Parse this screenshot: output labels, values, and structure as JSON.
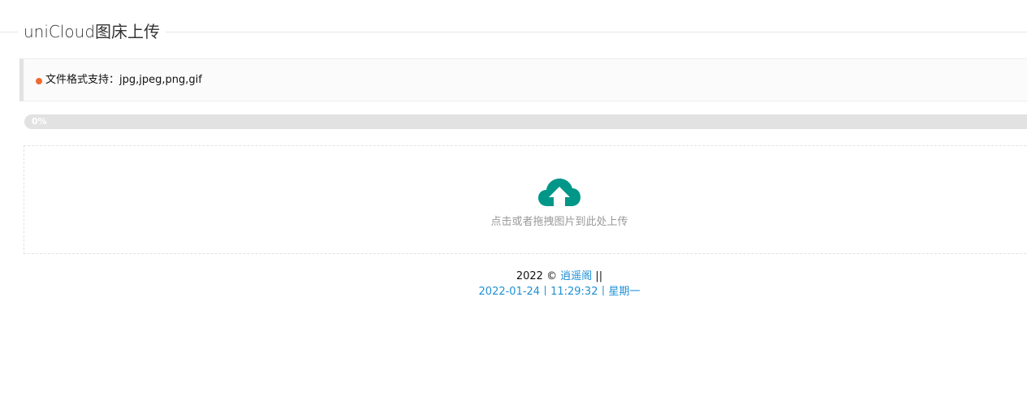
{
  "header": {
    "title": "uniCloud图床上传"
  },
  "notice": {
    "text": "文件格式支持：jpg,jpeg,png,gif",
    "dot_color": "#f16a31"
  },
  "progress": {
    "value": 0,
    "label": "0%"
  },
  "upload": {
    "icon": "cloud-upload-icon",
    "icon_color": "#009688",
    "hint": "点击或者拖拽图片到此处上传"
  },
  "footer": {
    "year_prefix": "2022 ©",
    "author_link": "逍遥阁",
    "separator": "||",
    "datetime": "2022-01-24丨11:29:32丨星期一",
    "link_color": "#1e90d6"
  }
}
